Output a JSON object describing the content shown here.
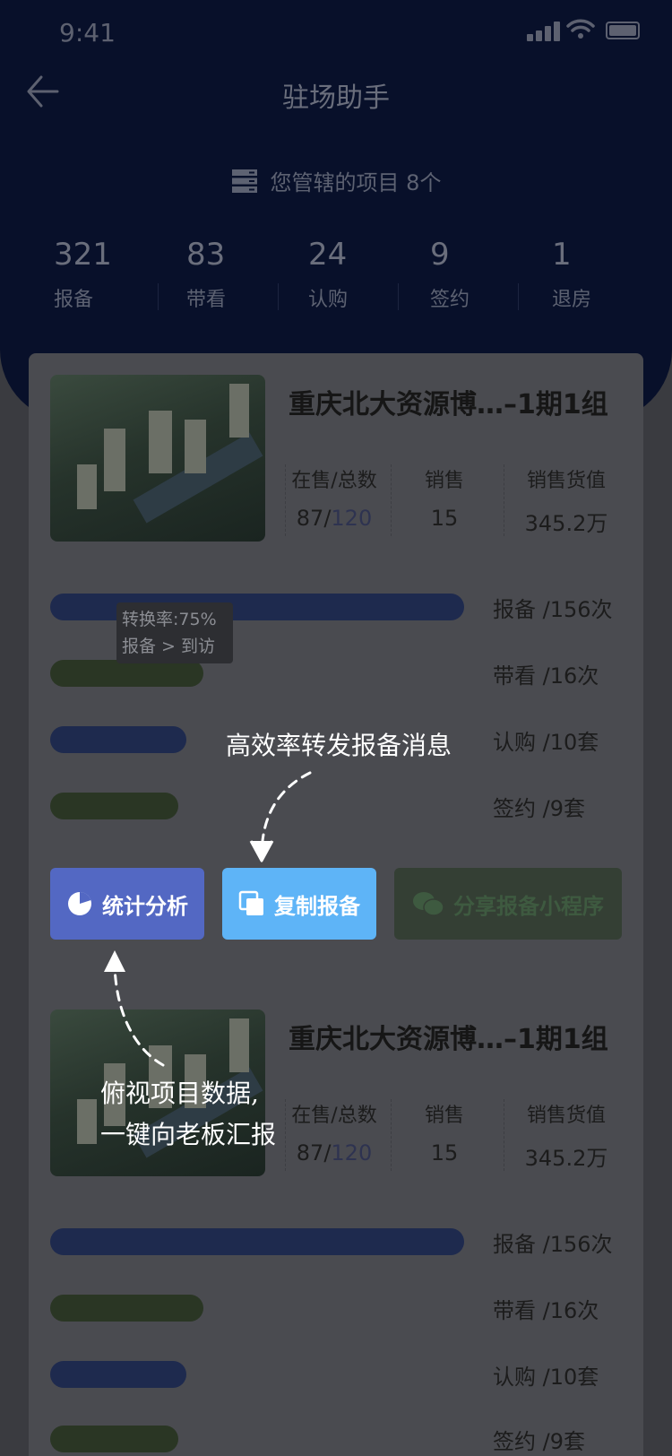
{
  "status_bar": {
    "time": "9:41"
  },
  "nav": {
    "title": "驻场助手"
  },
  "managed": {
    "label": "您管辖的项目 8个"
  },
  "stats": [
    {
      "value": "321",
      "label": "报备"
    },
    {
      "value": "83",
      "label": "带看"
    },
    {
      "value": "24",
      "label": "认购"
    },
    {
      "value": "9",
      "label": "签约"
    },
    {
      "value": "1",
      "label": "退房"
    }
  ],
  "projects": [
    {
      "title": "重庆北大资源博…–1期1组",
      "metrics": [
        {
          "label": "在售/总数",
          "value": "87/",
          "value_total": "120"
        },
        {
          "label": "销售",
          "value": "15"
        },
        {
          "label": "销售货值",
          "value": "345.2万"
        }
      ],
      "funnel": [
        {
          "label": "报备 /156次",
          "fraction": 1.0
        },
        {
          "label": "带看 /16次",
          "fraction": 0.37
        },
        {
          "label": "认购 /10套",
          "fraction": 0.33
        },
        {
          "label": "签约 /9套",
          "fraction": 0.31
        }
      ]
    },
    {
      "title": "重庆北大资源博…–1期1组",
      "metrics": [
        {
          "label": "在售/总数",
          "value": "87/",
          "value_total": "120"
        },
        {
          "label": "销售",
          "value": "15"
        },
        {
          "label": "销售货值",
          "value": "345.2万"
        }
      ],
      "funnel": [
        {
          "label": "报备 /156次",
          "fraction": 1.0
        },
        {
          "label": "带看 /16次",
          "fraction": 0.37
        },
        {
          "label": "认购 /10套",
          "fraction": 0.33
        },
        {
          "label": "签约 /9套",
          "fraction": 0.31
        }
      ]
    }
  ],
  "tooltip": {
    "line1": "转换率:75%",
    "line2": "报备 > 到访"
  },
  "buttons": {
    "stats": "统计分析",
    "copy": "复制报备",
    "share": "分享报备小程序"
  },
  "annotations": {
    "copy_hint": "高效率转发报备消息",
    "stats_hint_line1": "俯视项目数据,",
    "stats_hint_line2": "一键向老板汇报"
  },
  "colors": {
    "header_bg": "#08102a",
    "bar_blue": "#1e2a4e",
    "bar_green": "#2a3624",
    "btn_stats": "#5368c3",
    "btn_copy": "#5eb4f7",
    "btn_share": "#343f34"
  }
}
